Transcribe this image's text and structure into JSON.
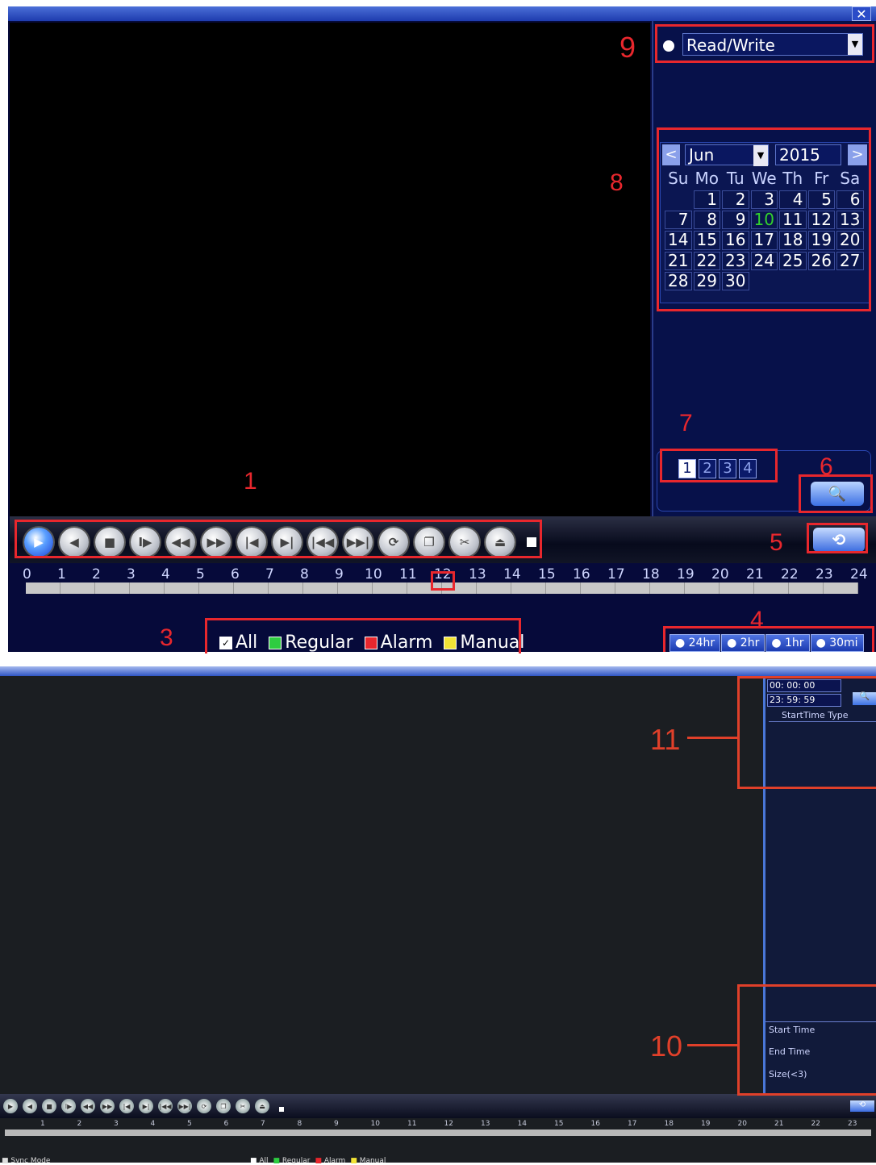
{
  "top": {
    "close_label": "✕",
    "mode_value": "Read/Write",
    "annotations": [
      "1",
      "3",
      "4",
      "5",
      "6",
      "7",
      "8",
      "9"
    ],
    "calendar": {
      "prev": "<",
      "next": ">",
      "month": "Jun",
      "year": "2015",
      "weekdays": [
        "Su",
        "Mo",
        "Tu",
        "We",
        "Th",
        "Fr",
        "Sa"
      ],
      "days": [
        "",
        "1",
        "2",
        "3",
        "4",
        "5",
        "6",
        "7",
        "8",
        "9",
        "10",
        "11",
        "12",
        "13",
        "14",
        "15",
        "16",
        "17",
        "18",
        "19",
        "20",
        "21",
        "22",
        "23",
        "24",
        "25",
        "26",
        "27",
        "28",
        "29",
        "30"
      ],
      "highlight_day": "10",
      "highlight_color": "#33d12e"
    },
    "channels": [
      "1",
      "2",
      "3",
      "4"
    ],
    "selected_channel": "1",
    "playback_buttons": [
      "play-icon",
      "previous-frame-icon",
      "stop-icon",
      "slow-play-icon",
      "fast-backward-icon",
      "fast-forward-icon",
      "previous-file-icon",
      "next-file-icon",
      "previous-day-icon",
      "next-day-icon",
      "loop-icon",
      "fullscreen-icon",
      "clip-icon",
      "backup-icon"
    ],
    "timeline_ticks": [
      "0",
      "1",
      "2",
      "3",
      "4",
      "5",
      "6",
      "7",
      "8",
      "9",
      "10",
      "11",
      "12",
      "13",
      "14",
      "15",
      "16",
      "17",
      "18",
      "19",
      "20",
      "21",
      "22",
      "23",
      "24"
    ],
    "legend": [
      {
        "label": "All",
        "color": "#ffffff"
      },
      {
        "label": "Regular",
        "color": "#2ecc40"
      },
      {
        "label": "Alarm",
        "color": "#e8272d"
      },
      {
        "label": "Manual",
        "color": "#f2e336"
      }
    ],
    "ranges": [
      "24hr",
      "2hr",
      "1hr",
      "30mi"
    ],
    "accent": "#e8272d"
  },
  "bottom": {
    "start_time": "00: 00: 00",
    "end_time": "23: 59: 59",
    "list_header": "StartTime Type",
    "info_labels": [
      "Start Time",
      "End Time",
      "Size(<3)"
    ],
    "annotations": [
      "11",
      "10"
    ],
    "timeline_ticks": [
      "1",
      "2",
      "3",
      "4",
      "5",
      "6",
      "7",
      "8",
      "9",
      "10",
      "11",
      "12",
      "13",
      "14",
      "15",
      "16",
      "17",
      "18",
      "19",
      "20",
      "21",
      "22",
      "23"
    ],
    "sync_mode": "Sync Mode",
    "legend_small": [
      "All",
      "Regular",
      "Alarm",
      "Manual"
    ]
  }
}
